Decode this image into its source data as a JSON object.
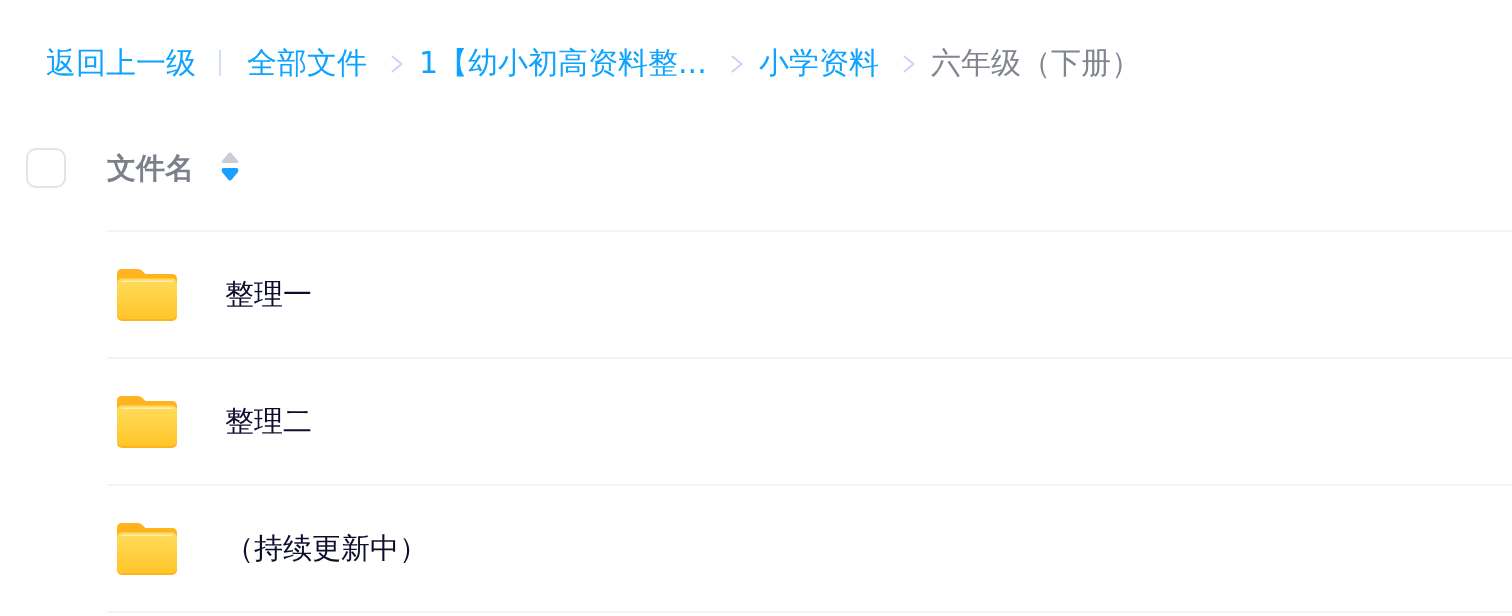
{
  "breadcrumb": {
    "back_link": "返回上一级",
    "items": [
      {
        "label": "全部文件",
        "current": false
      },
      {
        "label": "1【幼小初高资料整...",
        "current": false
      },
      {
        "label": "小学资料",
        "current": false
      },
      {
        "label": "六年级（下册）",
        "current": true
      }
    ]
  },
  "table": {
    "select_all": {
      "checked": false
    },
    "header": {
      "label": "文件名",
      "sort_ascending": false,
      "sort_descending": true
    },
    "rows": [
      {
        "name": "整理一",
        "kind": "folder"
      },
      {
        "name": "整理二",
        "kind": "folder"
      },
      {
        "name": "（持续更新中）",
        "kind": "folder"
      }
    ]
  }
}
